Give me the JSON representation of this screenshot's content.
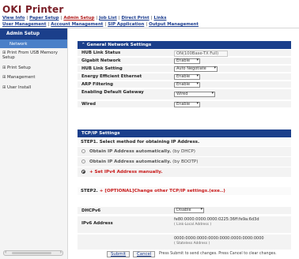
{
  "header": {
    "app_title": "OKI Printer",
    "nav_row1": [
      "View Info",
      "Paper Setup",
      "Admin Setup",
      "Job List",
      "Direct Print",
      "Links"
    ],
    "nav_row1_active": "Admin Setup",
    "nav_row2": [
      "User Management",
      "Account Management",
      "SIP Application",
      "Output Management"
    ]
  },
  "sidebar": {
    "heading": "Admin Setup",
    "selected": "Network",
    "items": [
      {
        "toggle": "⊞",
        "label": "Print From USB Memory Setup"
      },
      {
        "toggle": "⊞",
        "label": "Print Setup"
      },
      {
        "toggle": "⊞",
        "label": "Management"
      },
      {
        "toggle": "⊞",
        "label": "User Install"
      }
    ]
  },
  "general": {
    "heading": "General Network Settings",
    "collapse_glyph": "⌃",
    "hub_link_status": {
      "label": "HUB Link Status",
      "value": "ON(100Base-TX Full)"
    },
    "gigabit": {
      "label": "Gigabit Network",
      "value": "Enable"
    },
    "hub_link_setting": {
      "label": "HUB Link Setting",
      "value": "Auto Negotiate"
    },
    "energy": {
      "label": "Energy Efficient Ethernet",
      "value": "Enable"
    },
    "arp": {
      "label": "ARP Filtering",
      "value": "Enable"
    },
    "default_gateway": {
      "label": "Enabling Default Gateway",
      "value": "Wired"
    },
    "wired": {
      "label": "Wired",
      "value": "Enable"
    }
  },
  "tcpip": {
    "heading": "TCP/IP Settings",
    "step1": "STEP1.  Select method for obtaining IP Address.",
    "opt_dhcp": {
      "bold": "Obtain IP Address automatically.",
      "note": "(by DHCP)"
    },
    "opt_bootp": {
      "bold": "Obtain IP Address automatically.",
      "note": "(by BOOTP)"
    },
    "opt_manual": {
      "prefix": "+",
      "text": "Set IPv4 Address manually."
    },
    "step2": {
      "label": "STEP2.",
      "link": "[OPTIONAL]Change other TCP/IP settings.(exe..)"
    },
    "dhcpv6": {
      "label": "DHCPv6",
      "value": "Disable"
    },
    "ipv6": {
      "label": "IPv6 Address",
      "link_local": "fe80:0000:0000:0000:0225:36ff:fe9a:6d3d",
      "link_local_note": "( Link-Local Address )",
      "stateless": "0000:0000:0000:0000:0000:0000:0000:0000",
      "stateless_note": "( Stateless Address )"
    }
  },
  "footer": {
    "submit": "Submit",
    "cancel": "Cancel",
    "note": "Press Submit to send changes. Press Cancel to clear changes."
  }
}
